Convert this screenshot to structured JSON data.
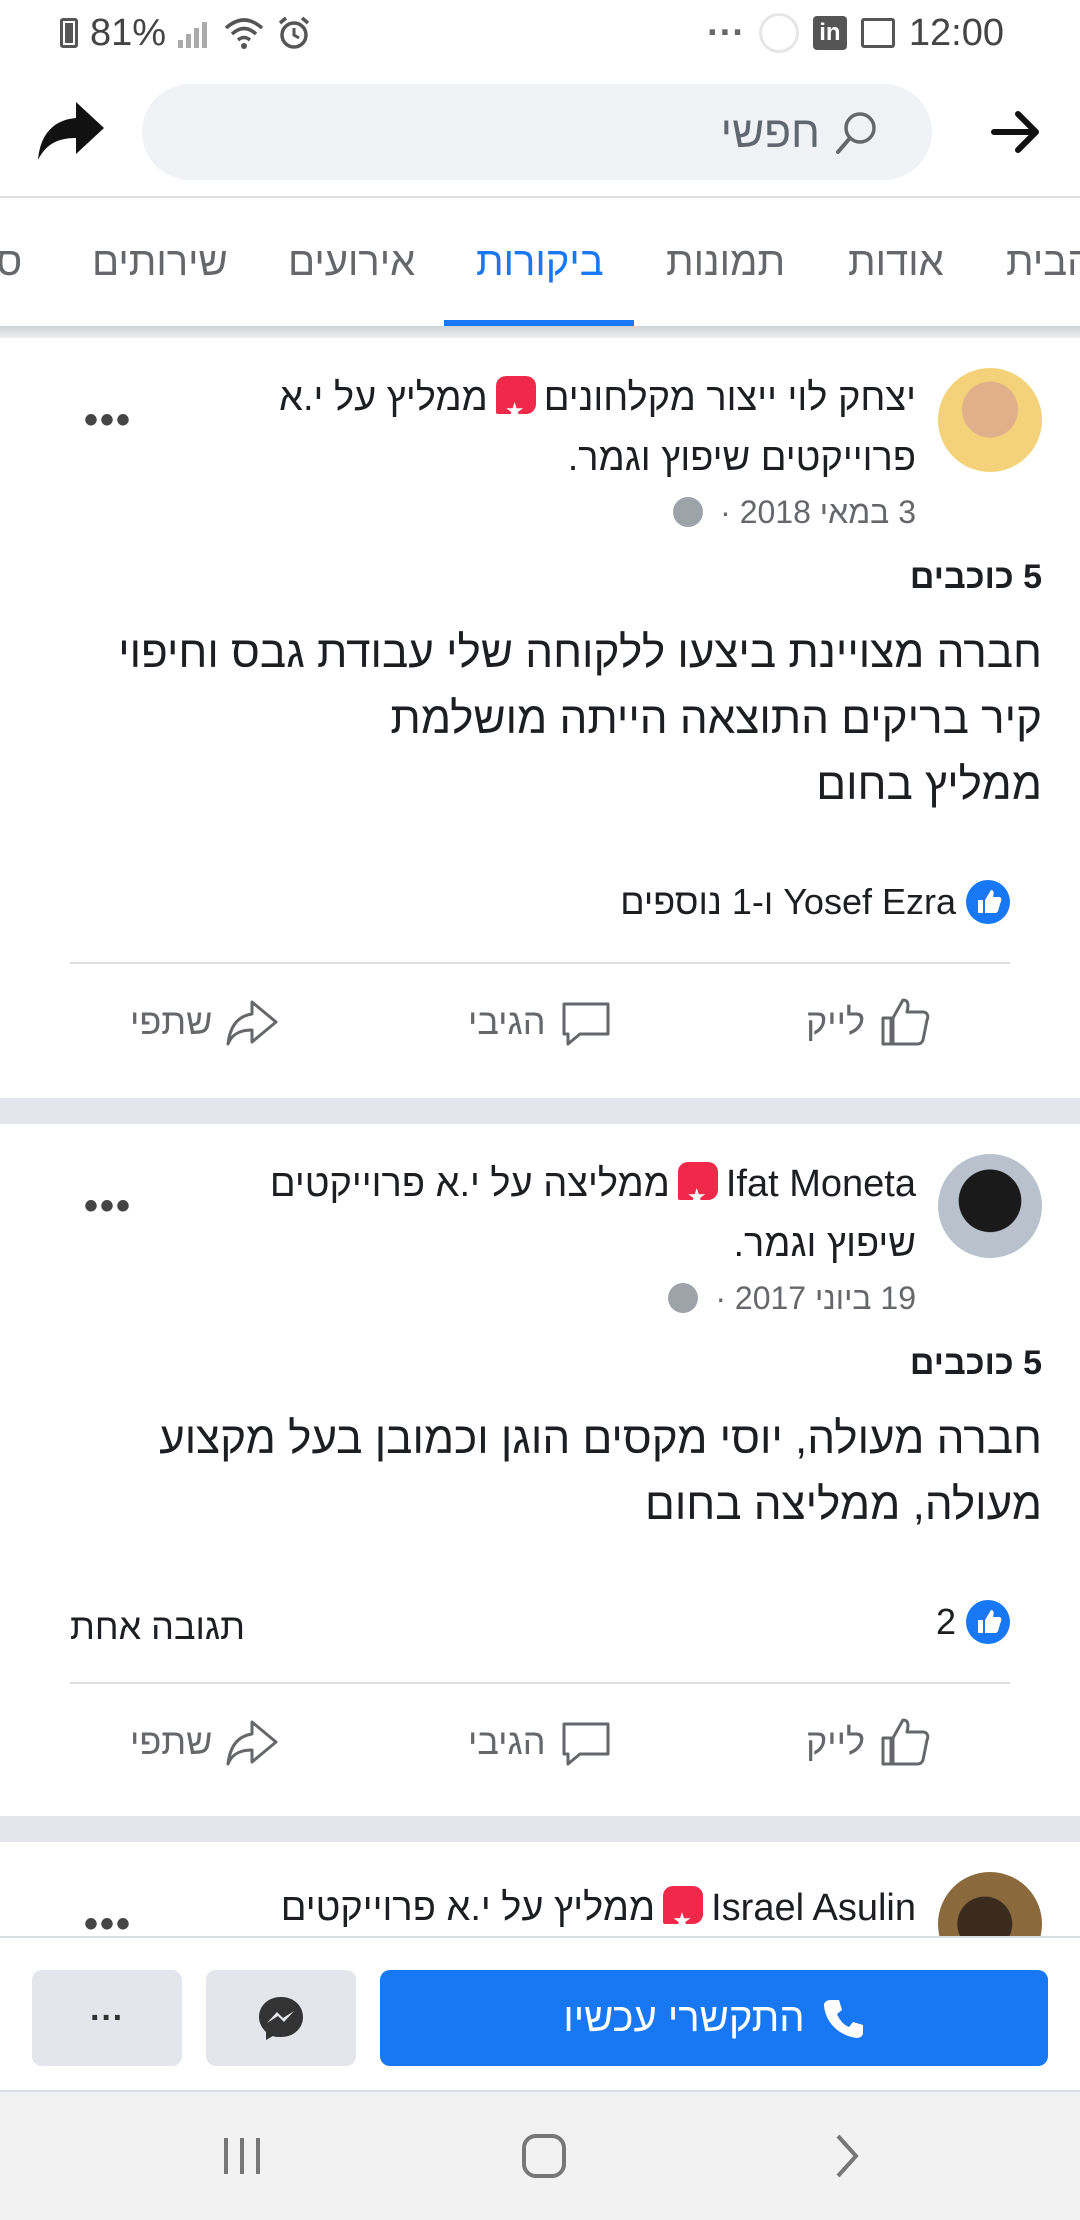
{
  "status_bar": {
    "battery": "81%",
    "time": "12:00",
    "dots": "···"
  },
  "search": {
    "placeholder": "חפשי"
  },
  "tabs": [
    {
      "label": "הבית"
    },
    {
      "label": "אודות"
    },
    {
      "label": "תמונות"
    },
    {
      "label": "ביקורות",
      "active": true
    },
    {
      "label": "אירועים"
    },
    {
      "label": "שירותים"
    },
    {
      "label": "ס"
    }
  ],
  "reviews": [
    {
      "author": "יצחק לוי ייצור מקלחונים",
      "recommend_text": "ממליץ על י.א",
      "page_line2": "פרוייקטים שיפוץ וגמר.",
      "date": "3 במאי 2018 ·",
      "rating": "5 כוכבים",
      "body": [
        "חברה מצויינת ביצעו ללקוחה שלי עבודת גבס וחיפוי",
        "קיר בריקים  התוצאה הייתה מושלמת",
        "ממליץ בחום"
      ],
      "reactions": "Yosef Ezra ו-1 נוספים",
      "comments": ""
    },
    {
      "author": "Ifat Moneta",
      "recommend_text": "ממליצה על י.א פרוייקטים",
      "page_line2": "שיפוץ וגמר.",
      "date": "19 ביוני 2017 ·",
      "rating": "5 כוכבים",
      "body": [
        "חברה מעולה, יוסי מקסים הוגן וכמובן בעל מקצוע",
        "מעולה, ממליצה בחום"
      ],
      "reactions": "2",
      "comments": "תגובה אחת"
    },
    {
      "author": "Israel Asulin",
      "recommend_text": "ממליץ על י.א פרוייקטים"
    }
  ],
  "actions": {
    "like": "לייק",
    "comment": "הגיבי",
    "share": "שתפי"
  },
  "bottom_bar": {
    "call": "התקשרי עכשיו",
    "more": "···"
  },
  "colors": {
    "accent": "#1877f2",
    "recommend": "#f02849",
    "muted": "#65676b"
  }
}
